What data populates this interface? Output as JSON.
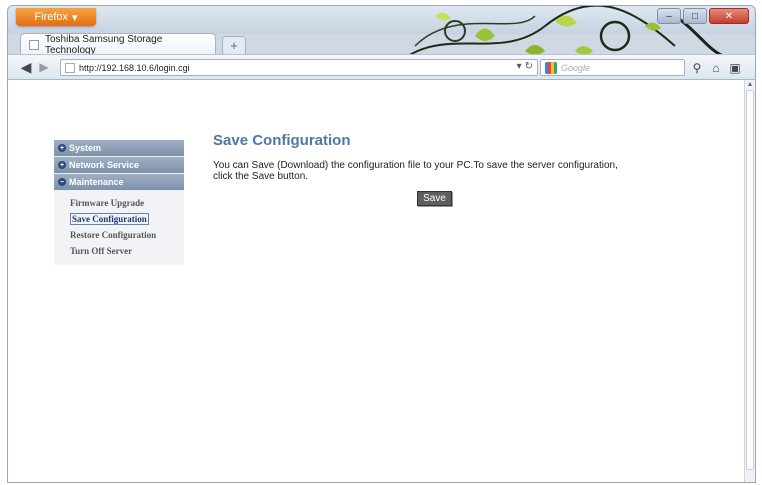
{
  "browser": {
    "menu_button": "Firefox",
    "tab_title": "Toshiba Samsung Storage Technology",
    "new_tab": "+",
    "url": "http://192.168.10.6/login.cgi",
    "search_placeholder": "Google",
    "window_controls": {
      "minimize": "–",
      "maximize": "□",
      "close": "✕"
    }
  },
  "sidebar": {
    "sections": [
      {
        "label": "System"
      },
      {
        "label": "Network Service"
      },
      {
        "label": "Maintenance"
      }
    ],
    "items": [
      {
        "label": "Firmware Upgrade"
      },
      {
        "label": "Save Configuration"
      },
      {
        "label": "Restore Configuration"
      },
      {
        "label": "Turn Off Server"
      }
    ]
  },
  "main": {
    "title": "Save Configuration",
    "description": "You can Save (Download) the configuration file to your PC.To save the server configuration, click the Save button.",
    "save_button": "Save"
  },
  "colors": {
    "accent": "#4c78a8",
    "menu_header": "#7d91aa",
    "firefox_button": "#e16d12"
  },
  "icons": [
    "back-arrow-icon",
    "forward-arrow-icon",
    "reload-icon",
    "home-icon",
    "bookmark-icon",
    "search-icon",
    "google-icon"
  ]
}
